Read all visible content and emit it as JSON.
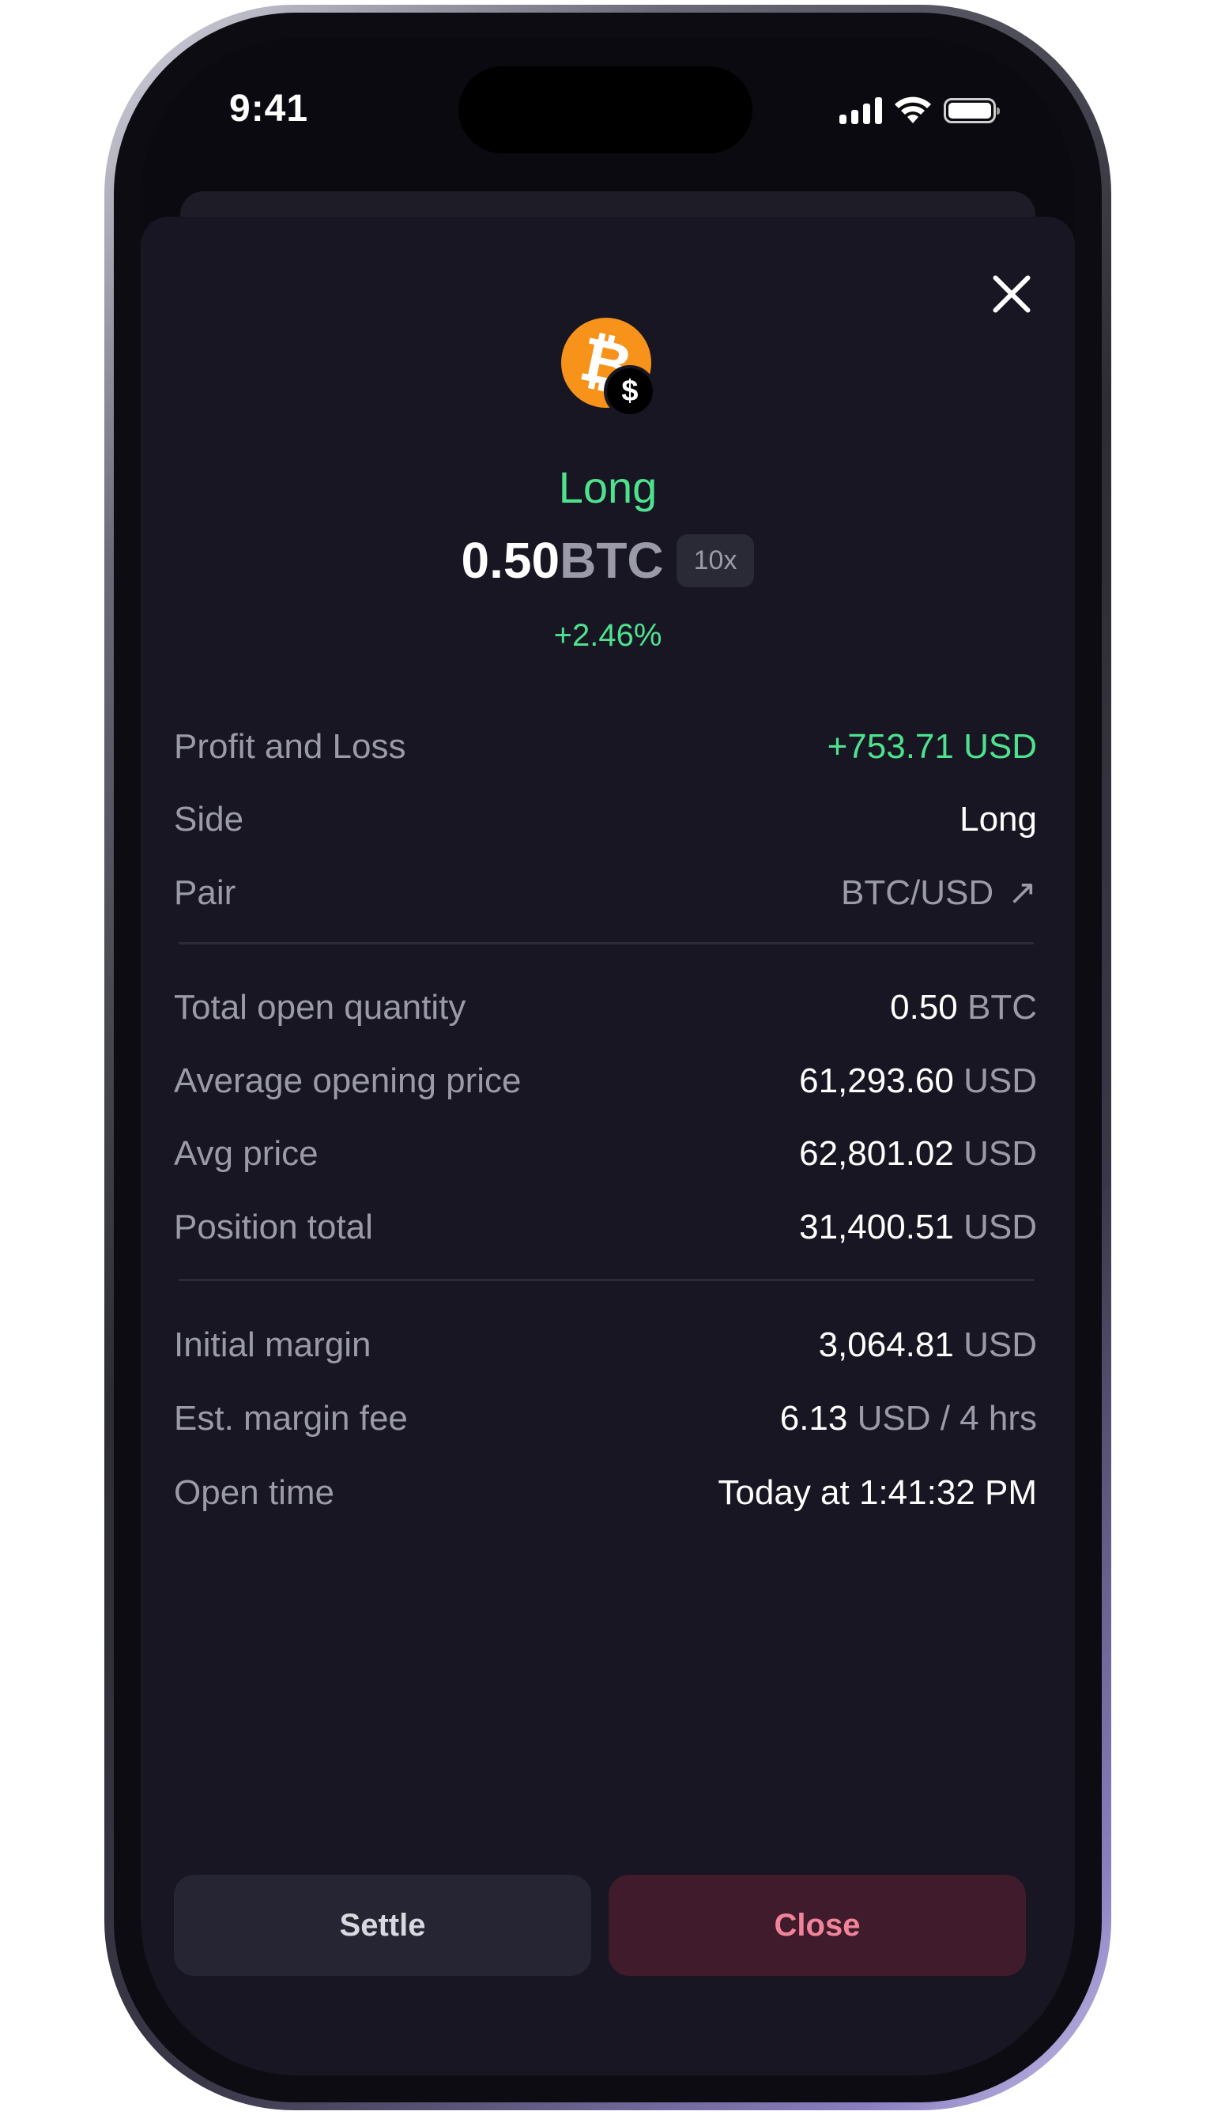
{
  "status_bar": {
    "time": "9:41"
  },
  "header": {
    "side": "Long",
    "amount": "0.50",
    "unit": "BTC",
    "leverage": "10x",
    "change": "+2.46%",
    "icons": {
      "coin": "bitcoin-icon",
      "badge": "dollar-icon",
      "close": "close-icon"
    }
  },
  "details": {
    "pnl": {
      "label": "Profit and Loss",
      "value": "+753.71 USD"
    },
    "side": {
      "label": "Side",
      "value": "Long"
    },
    "pair": {
      "label": "Pair",
      "value": "BTC/USD"
    },
    "total_qty": {
      "label": "Total open quantity",
      "value": "0.50",
      "unit": "BTC"
    },
    "avg_open_price": {
      "label": "Average opening price",
      "value": "61,293.60",
      "unit": "USD"
    },
    "avg_price": {
      "label": "Avg price",
      "value": "62,801.02",
      "unit": "USD"
    },
    "position_total": {
      "label": "Position total",
      "value": "31,400.51",
      "unit": "USD"
    },
    "initial_margin": {
      "label": "Initial margin",
      "value": "3,064.81",
      "unit": "USD"
    },
    "margin_fee": {
      "label": "Est. margin fee",
      "value": "6.13",
      "unit": "USD / 4 hrs"
    },
    "open_time": {
      "label": "Open time",
      "value": "Today at 1:41:32 PM"
    }
  },
  "actions": {
    "settle": "Settle",
    "close": "Close"
  },
  "colors": {
    "positive": "#4ee28f",
    "accent_close": "#f2849a",
    "bitcoin": "#f7931a"
  }
}
